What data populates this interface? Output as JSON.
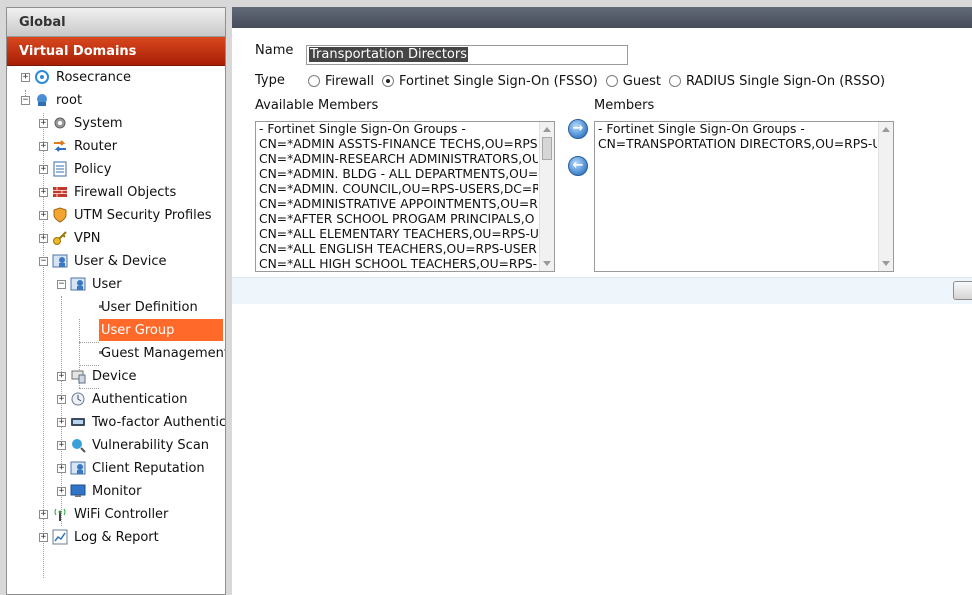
{
  "nav": {
    "global_label": "Global",
    "virtual_domains_label": "Virtual Domains",
    "items": {
      "rosecrance": "Rosecrance",
      "root": "root",
      "system": "System",
      "router": "Router",
      "policy": "Policy",
      "firewall_objects": "Firewall Objects",
      "utm_security_profiles": "UTM Security Profiles",
      "vpn": "VPN",
      "user_device": "User & Device",
      "user": "User",
      "user_definition": "User Definition",
      "user_group": "User Group",
      "guest_management": "Guest Management",
      "device": "Device",
      "authentication": "Authentication",
      "two_factor": "Two-factor Authentic",
      "vulnerability_scan": "Vulnerability Scan",
      "client_reputation": "Client Reputation",
      "monitor": "Monitor",
      "wifi_controller": "WiFi Controller",
      "log_report": "Log & Report"
    }
  },
  "form": {
    "name_label": "Name",
    "name_value": "Transportation Directors",
    "type_label": "Type",
    "type_options": [
      "Firewall",
      "Fortinet Single Sign-On (FSSO)",
      "Guest",
      "RADIUS Single Sign-On (RSSO)"
    ],
    "type_selected": "Fortinet Single Sign-On (FSSO)",
    "available_label": "Available Members",
    "members_label": "Members",
    "available_members": [
      "- Fortinet Single Sign-On Groups -",
      "CN=*ADMIN ASSTS-FINANCE TECHS,OU=RPS",
      "CN=*ADMIN-RESEARCH ADMINISTRATORS,OU",
      "CN=*ADMIN. BLDG - ALL DEPARTMENTS,OU=",
      "CN=*ADMIN. COUNCIL,OU=RPS-USERS,DC=R",
      "CN=*ADMINISTRATIVE APPOINTMENTS,OU=R",
      "CN=*AFTER SCHOOL PROGAM PRINCIPALS,O",
      "CN=*ALL ELEMENTARY TEACHERS,OU=RPS-U",
      "CN=*ALL ENGLISH TEACHERS,OU=RPS-USER",
      "CN=*ALL HIGH SCHOOL TEACHERS,OU=RPS-"
    ],
    "members": [
      "- Fortinet Single Sign-On Groups -",
      "CN=TRANSPORTATION DIRECTORS,OU=RPS-U"
    ]
  },
  "colors": {
    "vd_header": "#b82c0e",
    "selected_item": "#ff6a2a",
    "main_bar": "#535a66"
  }
}
